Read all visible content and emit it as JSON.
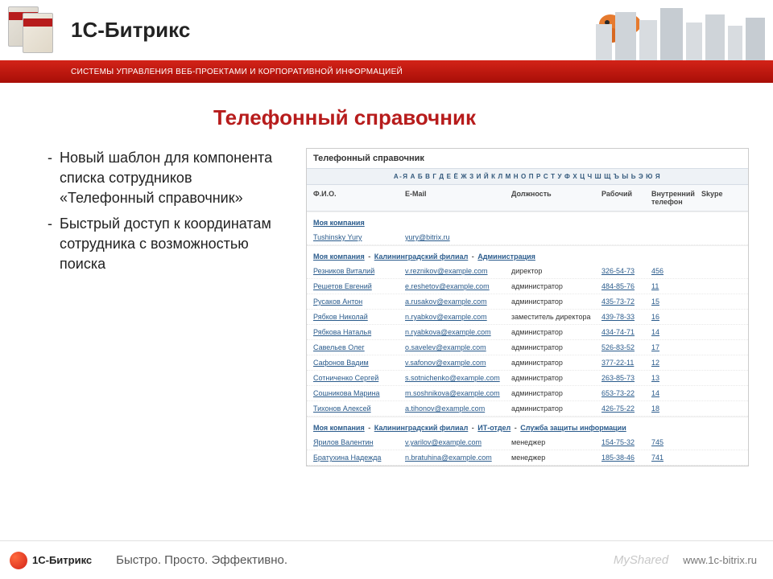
{
  "header": {
    "brand": "1С-Битрикс",
    "tagline": "СИСТЕМЫ УПРАВЛЕНИЯ ВЕБ-ПРОЕКТАМИ И КОРПОРАТИВНОЙ ИНФОРМАЦИЕЙ"
  },
  "title": "Телефонный справочник",
  "bullets": [
    "Новый шаблон для компонента списка сотрудников «Телефонный справочник»",
    "Быстрый доступ к координатам сотрудника с возможностью поиска"
  ],
  "screenshot": {
    "title": "Телефонный справочник",
    "alpha": [
      "А-Я",
      "А",
      "Б",
      "В",
      "Г",
      "Д",
      "Е",
      "Ё",
      "Ж",
      "З",
      "И",
      "Й",
      "К",
      "Л",
      "М",
      "Н",
      "О",
      "П",
      "Р",
      "С",
      "Т",
      "У",
      "Ф",
      "Х",
      "Ц",
      "Ч",
      "Ш",
      "Щ",
      "Ъ",
      "Ы",
      "Ь",
      "Э",
      "Ю",
      "Я"
    ],
    "columns": {
      "c1": "Ф.И.О.",
      "c2": "E-Mail",
      "c3": "Должность",
      "c4": "Рабочий",
      "c5": "Внутренний телефон",
      "c6": "Skype"
    },
    "groups": [
      {
        "path": [
          "Моя компания"
        ],
        "rows": [
          {
            "name": "Tushinsky Yury",
            "email": "yury@bitrix.ru",
            "role": "",
            "work": "",
            "ext": "",
            "skype": ""
          }
        ]
      },
      {
        "path": [
          "Моя компания",
          "Калининградский филиал",
          "Администрация"
        ],
        "rows": [
          {
            "name": "Резников Виталий",
            "email": "v.reznikov@example.com",
            "role": "директор",
            "work": "326-54-73",
            "ext": "456",
            "skype": ""
          },
          {
            "name": "Решетов Евгений",
            "email": "e.reshetov@example.com",
            "role": "администратор",
            "work": "484-85-76",
            "ext": "11",
            "skype": ""
          },
          {
            "name": "Русаков Антон",
            "email": "a.rusakov@example.com",
            "role": "администратор",
            "work": "435-73-72",
            "ext": "15",
            "skype": ""
          },
          {
            "name": "Рябков Николай",
            "email": "n.ryabkov@example.com",
            "role": "заместитель директора",
            "work": "439-78-33",
            "ext": "16",
            "skype": ""
          },
          {
            "name": "Рябкова Наталья",
            "email": "n.ryabkova@example.com",
            "role": "администратор",
            "work": "434-74-71",
            "ext": "14",
            "skype": ""
          },
          {
            "name": "Савельев Олег",
            "email": "o.savelev@example.com",
            "role": "администратор",
            "work": "526-83-52",
            "ext": "17",
            "skype": ""
          },
          {
            "name": "Сафонов Вадим",
            "email": "v.safonov@example.com",
            "role": "администратор",
            "work": "377-22-11",
            "ext": "12",
            "skype": ""
          },
          {
            "name": "Сотниченко Сергей",
            "email": "s.sotnichenko@example.com",
            "role": "администратор",
            "work": "263-85-73",
            "ext": "13",
            "skype": ""
          },
          {
            "name": "Сошникова Марина",
            "email": "m.soshnikova@example.com",
            "role": "администратор",
            "work": "653-73-22",
            "ext": "14",
            "skype": ""
          },
          {
            "name": "Тихонов Алексей",
            "email": "a.tihonov@example.com",
            "role": "администратор",
            "work": "426-75-22",
            "ext": "18",
            "skype": ""
          }
        ]
      },
      {
        "path": [
          "Моя компания",
          "Калининградский филиал",
          "ИТ-отдел",
          "Служба защиты информации"
        ],
        "rows": [
          {
            "name": "Ярилов Валентин",
            "email": "v.yarilov@example.com",
            "role": "менеджер",
            "work": "154-75-32",
            "ext": "745",
            "skype": ""
          },
          {
            "name": "Братухина Надежда",
            "email": "n.bratuhina@example.com",
            "role": "менеджер",
            "work": "185-38-46",
            "ext": "741",
            "skype": ""
          }
        ]
      }
    ]
  },
  "footer": {
    "brand": "1С-Битрикс",
    "slogan": "Быстро. Просто. Эффективно.",
    "watermark": "MyShared",
    "url": "www.1c-bitrix.ru"
  }
}
